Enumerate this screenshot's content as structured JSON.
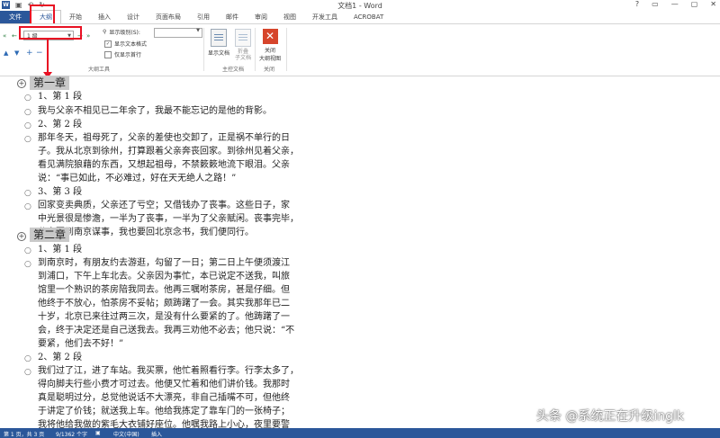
{
  "window": {
    "title": "文档1 - Word",
    "controls": [
      "?",
      "▭",
      "—",
      "▢",
      "✕"
    ],
    "quick_access": [
      "💾",
      "↶",
      "↷"
    ]
  },
  "tabs": {
    "file": "文件",
    "outline": "大纲",
    "home": "开始",
    "insert": "插入",
    "design": "设计",
    "layout": "页面布局",
    "references": "引用",
    "mailings": "邮件",
    "review": "审阅",
    "view": "视图",
    "developer": "开发工具",
    "acrobat": "ACROBAT"
  },
  "ribbon": {
    "level_value": "1 级",
    "show_level_label": "显示级别(S):",
    "show_text_format": "显示文本格式",
    "show_first_line": "仅显示首行",
    "group_outline_tools": "大纲工具",
    "show_document": "显示文档",
    "collapse_subdocs": "折叠\n子文档",
    "group_master": "主控文档",
    "close_outline_line1": "关闭",
    "close_outline_line2": "大纲视图",
    "group_close": "关闭"
  },
  "document": {
    "ch1": "第一章",
    "c1p1_title": "1、第 1 段",
    "c1p1_l1": "我与父亲不相见已二年余了，我最不能忘记的是他的背影。",
    "c1p2_title": "2、第 2 段",
    "c1p2_l1": "那年冬天，祖母死了，父亲的差使也交卸了，正是祸不单行的日",
    "c1p2_l2": "子。我从北京到徐州，打算跟着父亲奔丧回家。到徐州见着父亲，",
    "c1p2_l3": "看见满院狼藉的东西，又想起祖母，不禁簌簌地流下眼泪。父亲",
    "c1p2_l4": "说：“事已如此，不必难过，好在天无绝人之路！”",
    "c1p3_title": "3、第 3 段",
    "c1p3_l1": "回家变卖典质，父亲还了亏空；又借钱办了丧事。这些日子，家",
    "c1p3_l2": "中光景很是惨澹，一半为了丧事，一半为了父亲赋闲。丧事完毕，",
    "c1p3_l3": "父亲要到南京谋事，我也要回北京念书，我们便同行。",
    "ch2": "第二章",
    "c2p1_title": "1、第 1 段",
    "c2p1_l1": "到南京时，有朋友约去游逛，勾留了一日；第二日上午便须渡江",
    "c2p1_l2": "到浦口，下午上车北去。父亲因为事忙，本已说定不送我，叫旅",
    "c2p1_l3": "馆里一个熟识的茶房陪我同去。他再三嘱咐茶房，甚是仔细。但",
    "c2p1_l4": "他终于不放心，怕茶房不妥帖；颇踌躇了一会。其实我那年已二",
    "c2p1_l5": "十岁，北京已来往过两三次，是没有什么要紧的了。他踌躇了一",
    "c2p1_l6": "会，终于决定还是自己送我去。我再三劝他不必去；他只说：“不",
    "c2p1_l7": "要紧，他们去不好！”",
    "c2p2_title": "2、第 2 段",
    "c2p2_l1": "我们过了江，进了车站。我买票，他忙着照看行李。行李太多了，",
    "c2p2_l2": "得向脚夫行些小费才可过去。他便又忙着和他们讲价钱。我那时",
    "c2p2_l3": "真是聪明过分，总觉他说话不大漂亮，非自己插嘴不可，但他终",
    "c2p2_l4": "于讲定了价钱；就送我上车。他给我拣定了靠车门的一张椅子；",
    "c2p2_l5": "我将他给我做的紫毛大衣铺好座位。他嘱我路上小心，夜里要警"
  },
  "status": {
    "page": "第 1 页，共 3 页",
    "words": "9/1362 个字",
    "lang": "中文(中国)",
    "mode": "插入"
  },
  "watermark": "头条 @系统正在升级inglk",
  "colors": {
    "accent": "#2b579a",
    "highlight_red": "#e81123",
    "heading_bg": "#c9c9c9"
  }
}
